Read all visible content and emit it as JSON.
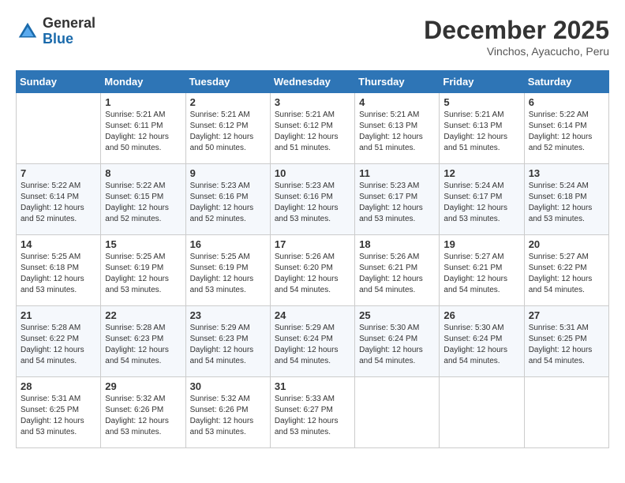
{
  "header": {
    "logo_general": "General",
    "logo_blue": "Blue",
    "month_title": "December 2025",
    "subtitle": "Vinchos, Ayacucho, Peru"
  },
  "days_of_week": [
    "Sunday",
    "Monday",
    "Tuesday",
    "Wednesday",
    "Thursday",
    "Friday",
    "Saturday"
  ],
  "weeks": [
    [
      {
        "day": "",
        "sunrise": "",
        "sunset": "",
        "daylight": ""
      },
      {
        "day": "1",
        "sunrise": "Sunrise: 5:21 AM",
        "sunset": "Sunset: 6:11 PM",
        "daylight": "Daylight: 12 hours and 50 minutes."
      },
      {
        "day": "2",
        "sunrise": "Sunrise: 5:21 AM",
        "sunset": "Sunset: 6:12 PM",
        "daylight": "Daylight: 12 hours and 50 minutes."
      },
      {
        "day": "3",
        "sunrise": "Sunrise: 5:21 AM",
        "sunset": "Sunset: 6:12 PM",
        "daylight": "Daylight: 12 hours and 51 minutes."
      },
      {
        "day": "4",
        "sunrise": "Sunrise: 5:21 AM",
        "sunset": "Sunset: 6:13 PM",
        "daylight": "Daylight: 12 hours and 51 minutes."
      },
      {
        "day": "5",
        "sunrise": "Sunrise: 5:21 AM",
        "sunset": "Sunset: 6:13 PM",
        "daylight": "Daylight: 12 hours and 51 minutes."
      },
      {
        "day": "6",
        "sunrise": "Sunrise: 5:22 AM",
        "sunset": "Sunset: 6:14 PM",
        "daylight": "Daylight: 12 hours and 52 minutes."
      }
    ],
    [
      {
        "day": "7",
        "sunrise": "Sunrise: 5:22 AM",
        "sunset": "Sunset: 6:14 PM",
        "daylight": "Daylight: 12 hours and 52 minutes."
      },
      {
        "day": "8",
        "sunrise": "Sunrise: 5:22 AM",
        "sunset": "Sunset: 6:15 PM",
        "daylight": "Daylight: 12 hours and 52 minutes."
      },
      {
        "day": "9",
        "sunrise": "Sunrise: 5:23 AM",
        "sunset": "Sunset: 6:16 PM",
        "daylight": "Daylight: 12 hours and 52 minutes."
      },
      {
        "day": "10",
        "sunrise": "Sunrise: 5:23 AM",
        "sunset": "Sunset: 6:16 PM",
        "daylight": "Daylight: 12 hours and 53 minutes."
      },
      {
        "day": "11",
        "sunrise": "Sunrise: 5:23 AM",
        "sunset": "Sunset: 6:17 PM",
        "daylight": "Daylight: 12 hours and 53 minutes."
      },
      {
        "day": "12",
        "sunrise": "Sunrise: 5:24 AM",
        "sunset": "Sunset: 6:17 PM",
        "daylight": "Daylight: 12 hours and 53 minutes."
      },
      {
        "day": "13",
        "sunrise": "Sunrise: 5:24 AM",
        "sunset": "Sunset: 6:18 PM",
        "daylight": "Daylight: 12 hours and 53 minutes."
      }
    ],
    [
      {
        "day": "14",
        "sunrise": "Sunrise: 5:25 AM",
        "sunset": "Sunset: 6:18 PM",
        "daylight": "Daylight: 12 hours and 53 minutes."
      },
      {
        "day": "15",
        "sunrise": "Sunrise: 5:25 AM",
        "sunset": "Sunset: 6:19 PM",
        "daylight": "Daylight: 12 hours and 53 minutes."
      },
      {
        "day": "16",
        "sunrise": "Sunrise: 5:25 AM",
        "sunset": "Sunset: 6:19 PM",
        "daylight": "Daylight: 12 hours and 53 minutes."
      },
      {
        "day": "17",
        "sunrise": "Sunrise: 5:26 AM",
        "sunset": "Sunset: 6:20 PM",
        "daylight": "Daylight: 12 hours and 54 minutes."
      },
      {
        "day": "18",
        "sunrise": "Sunrise: 5:26 AM",
        "sunset": "Sunset: 6:21 PM",
        "daylight": "Daylight: 12 hours and 54 minutes."
      },
      {
        "day": "19",
        "sunrise": "Sunrise: 5:27 AM",
        "sunset": "Sunset: 6:21 PM",
        "daylight": "Daylight: 12 hours and 54 minutes."
      },
      {
        "day": "20",
        "sunrise": "Sunrise: 5:27 AM",
        "sunset": "Sunset: 6:22 PM",
        "daylight": "Daylight: 12 hours and 54 minutes."
      }
    ],
    [
      {
        "day": "21",
        "sunrise": "Sunrise: 5:28 AM",
        "sunset": "Sunset: 6:22 PM",
        "daylight": "Daylight: 12 hours and 54 minutes."
      },
      {
        "day": "22",
        "sunrise": "Sunrise: 5:28 AM",
        "sunset": "Sunset: 6:23 PM",
        "daylight": "Daylight: 12 hours and 54 minutes."
      },
      {
        "day": "23",
        "sunrise": "Sunrise: 5:29 AM",
        "sunset": "Sunset: 6:23 PM",
        "daylight": "Daylight: 12 hours and 54 minutes."
      },
      {
        "day": "24",
        "sunrise": "Sunrise: 5:29 AM",
        "sunset": "Sunset: 6:24 PM",
        "daylight": "Daylight: 12 hours and 54 minutes."
      },
      {
        "day": "25",
        "sunrise": "Sunrise: 5:30 AM",
        "sunset": "Sunset: 6:24 PM",
        "daylight": "Daylight: 12 hours and 54 minutes."
      },
      {
        "day": "26",
        "sunrise": "Sunrise: 5:30 AM",
        "sunset": "Sunset: 6:24 PM",
        "daylight": "Daylight: 12 hours and 54 minutes."
      },
      {
        "day": "27",
        "sunrise": "Sunrise: 5:31 AM",
        "sunset": "Sunset: 6:25 PM",
        "daylight": "Daylight: 12 hours and 54 minutes."
      }
    ],
    [
      {
        "day": "28",
        "sunrise": "Sunrise: 5:31 AM",
        "sunset": "Sunset: 6:25 PM",
        "daylight": "Daylight: 12 hours and 53 minutes."
      },
      {
        "day": "29",
        "sunrise": "Sunrise: 5:32 AM",
        "sunset": "Sunset: 6:26 PM",
        "daylight": "Daylight: 12 hours and 53 minutes."
      },
      {
        "day": "30",
        "sunrise": "Sunrise: 5:32 AM",
        "sunset": "Sunset: 6:26 PM",
        "daylight": "Daylight: 12 hours and 53 minutes."
      },
      {
        "day": "31",
        "sunrise": "Sunrise: 5:33 AM",
        "sunset": "Sunset: 6:27 PM",
        "daylight": "Daylight: 12 hours and 53 minutes."
      },
      {
        "day": "",
        "sunrise": "",
        "sunset": "",
        "daylight": ""
      },
      {
        "day": "",
        "sunrise": "",
        "sunset": "",
        "daylight": ""
      },
      {
        "day": "",
        "sunrise": "",
        "sunset": "",
        "daylight": ""
      }
    ]
  ]
}
